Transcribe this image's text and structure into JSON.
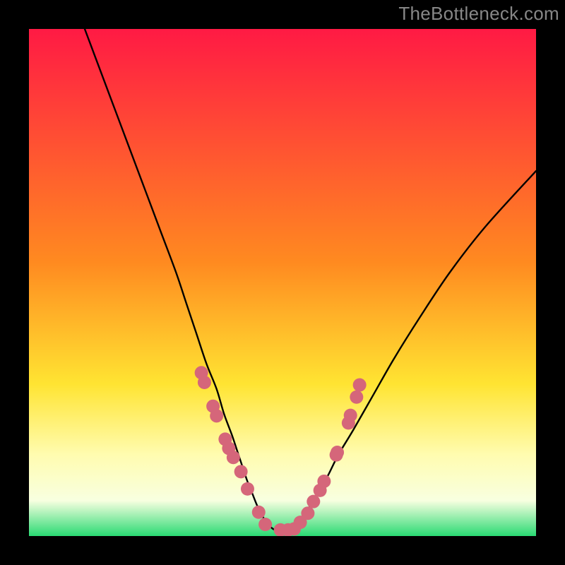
{
  "watermark": "TheBottleneck.com",
  "colors": {
    "gradient_top": "#ff1a44",
    "gradient_mid1": "#ff8a20",
    "gradient_mid2": "#ffe432",
    "gradient_yellowwhite": "#fffcb0",
    "gradient_pale": "#f8ffe0",
    "gradient_green": "#2ada73",
    "curve": "#000000",
    "marker_fill": "#d5667a",
    "marker_stroke": "#d5667a"
  },
  "chart_data": {
    "type": "line",
    "title": "",
    "xlabel": "",
    "ylabel": "",
    "xlim": [
      0,
      100
    ],
    "ylim": [
      0,
      100
    ],
    "series": [
      {
        "name": "bottleneck-curve",
        "x": [
          11,
          14,
          17,
          20,
          23,
          26,
          29,
          31,
          33,
          35,
          37,
          38.5,
          40,
          41,
          42,
          43,
          44,
          45,
          46,
          47,
          48,
          49,
          50,
          51,
          52,
          53,
          54,
          55.5,
          57,
          59,
          61,
          64,
          68,
          72,
          77,
          83,
          90,
          100
        ],
        "y": [
          100,
          92,
          84,
          76,
          68,
          60,
          52,
          46,
          40,
          34,
          29,
          24,
          20,
          17,
          14,
          11,
          8.5,
          6,
          4,
          2.5,
          1.5,
          1,
          1,
          1,
          1.5,
          2.5,
          4,
          6,
          8.5,
          12,
          16,
          21,
          28,
          35,
          43,
          52,
          61,
          72
        ]
      },
      {
        "name": "markers-left",
        "x": [
          34,
          34.6,
          36.3,
          37,
          38.7,
          39.4,
          40.3,
          41.8,
          43.1,
          45.3,
          46.6
        ],
        "y": [
          32.2,
          30.3,
          25.6,
          23.7,
          19.1,
          17.3,
          15.5,
          12.7,
          9.3,
          4.7,
          2.3
        ]
      },
      {
        "name": "markers-right",
        "x": [
          49.6,
          51.1,
          52.3,
          53.5,
          55.0,
          56.1,
          57.4,
          58.2,
          60.6,
          60.8,
          63.0,
          63.4,
          64.6,
          65.2
        ],
        "y": [
          1.2,
          1.2,
          1.4,
          2.7,
          4.5,
          6.8,
          9.0,
          10.8,
          16.0,
          16.5,
          22.3,
          23.8,
          27.4,
          29.8
        ]
      }
    ]
  }
}
